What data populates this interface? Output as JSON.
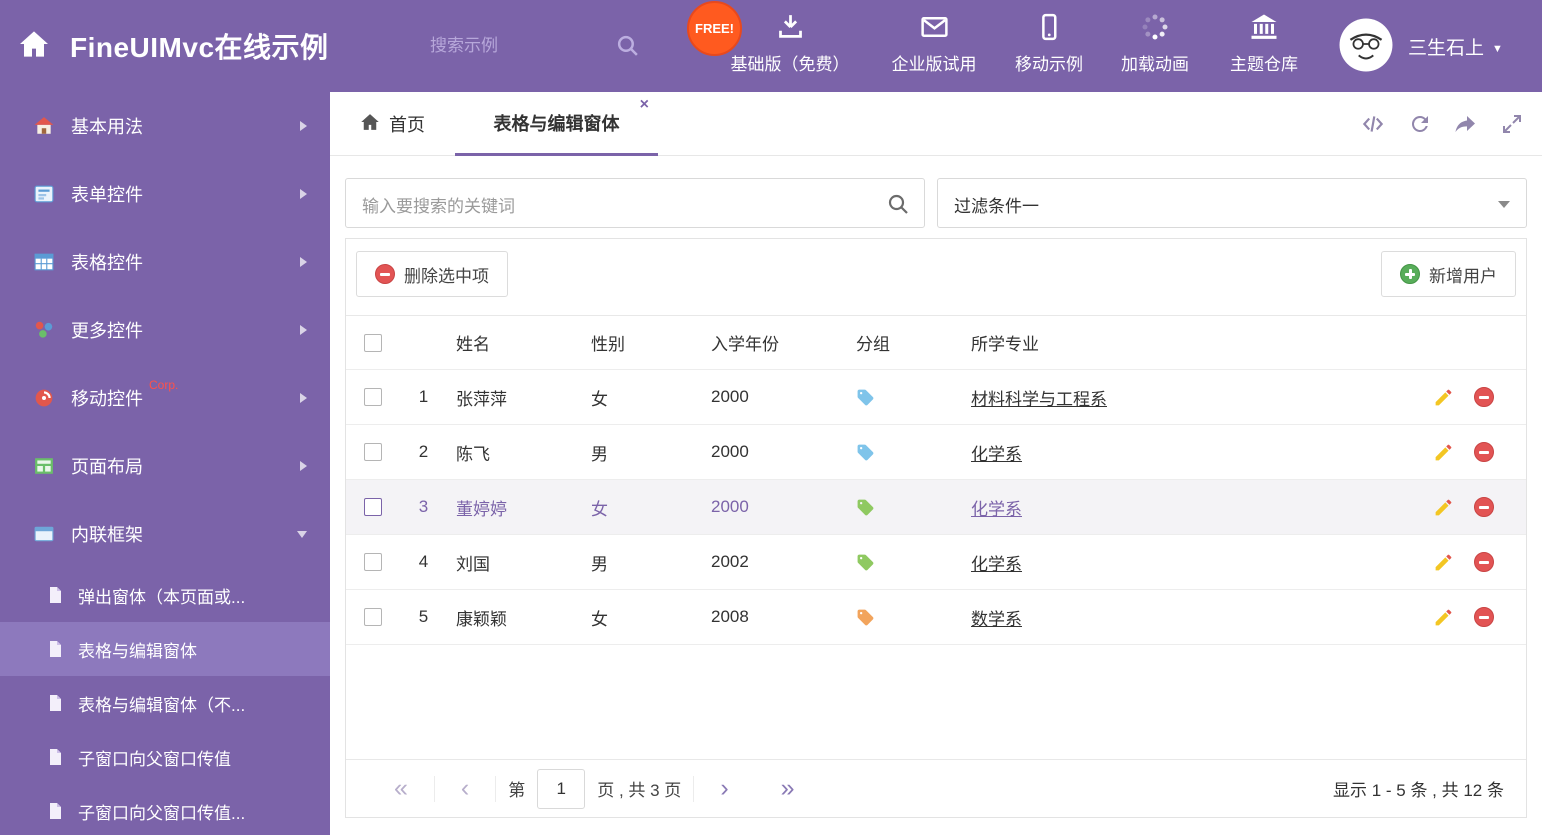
{
  "colors": {
    "accent": "#7b63a9"
  },
  "header": {
    "title": "FineUIMvc在线示例",
    "search_placeholder": "搜索示例",
    "free_badge": "FREE!",
    "nav": [
      {
        "label": "基础版（免费）",
        "icon": "download-icon"
      },
      {
        "label": "企业版试用",
        "icon": "envelope-icon"
      },
      {
        "label": "移动示例",
        "icon": "mobile-icon"
      },
      {
        "label": "加载动画",
        "icon": "spinner-icon"
      },
      {
        "label": "主题仓库",
        "icon": "bank-icon"
      }
    ],
    "user": {
      "name": "三生石上"
    }
  },
  "sidebar": {
    "items": [
      {
        "label": "基本用法"
      },
      {
        "label": "表单控件"
      },
      {
        "label": "表格控件"
      },
      {
        "label": "更多控件"
      },
      {
        "label": "移动控件",
        "badge": "Corp."
      },
      {
        "label": "页面布局"
      },
      {
        "label": "内联框架",
        "expanded": true
      }
    ],
    "subitems": [
      {
        "label": "弹出窗体（本页面或..."
      },
      {
        "label": "表格与编辑窗体",
        "active": true
      },
      {
        "label": "表格与编辑窗体（不..."
      },
      {
        "label": "子窗口向父窗口传值"
      },
      {
        "label": "子窗口向父窗口传值..."
      }
    ]
  },
  "tabs": {
    "home": "首页",
    "active": "表格与编辑窗体"
  },
  "filters": {
    "search_placeholder": "输入要搜索的关键词",
    "filter_value": "过滤条件一"
  },
  "toolbar": {
    "delete": "删除选中项",
    "add": "新增用户"
  },
  "table": {
    "columns": [
      "姓名",
      "性别",
      "入学年份",
      "分组",
      "所学专业"
    ],
    "rows": [
      {
        "num": "1",
        "name": "张萍萍",
        "gender": "女",
        "year": "2000",
        "tag_color": "#7fc4ea",
        "major": "材料科学与工程系",
        "selected": false
      },
      {
        "num": "2",
        "name": "陈飞",
        "gender": "男",
        "year": "2000",
        "tag_color": "#7fc4ea",
        "major": "化学系",
        "selected": false
      },
      {
        "num": "3",
        "name": "董婷婷",
        "gender": "女",
        "year": "2000",
        "tag_color": "#8fc961",
        "major": "化学系",
        "selected": true
      },
      {
        "num": "4",
        "name": "刘国",
        "gender": "男",
        "year": "2002",
        "tag_color": "#8fc961",
        "major": "化学系",
        "selected": false
      },
      {
        "num": "5",
        "name": "康颖颖",
        "gender": "女",
        "year": "2008",
        "tag_color": "#f2a45c",
        "major": "数学系",
        "selected": false
      }
    ]
  },
  "pagination": {
    "prefix": "第",
    "page": "1",
    "suffix": "页 , 共 3 页",
    "summary": "显示 1 - 5 条 , 共 12 条"
  }
}
